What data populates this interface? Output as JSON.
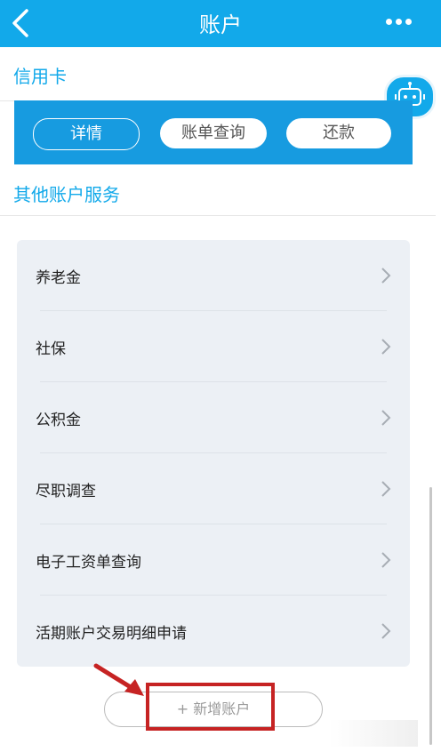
{
  "header": {
    "title": "账户",
    "back_icon": "chevron-left-icon",
    "more_icon": "more-dots-icon",
    "bar_color": "#12a9ea"
  },
  "credit_card": {
    "section_title": "信用卡",
    "buttons": [
      "详情",
      "账单查询",
      "还款"
    ]
  },
  "other_services": {
    "section_title": "其他账户服务",
    "items": [
      {
        "label": "养老金"
      },
      {
        "label": "社保"
      },
      {
        "label": "公积金"
      },
      {
        "label": "尽职调查"
      },
      {
        "label": "电子工资单查询"
      },
      {
        "label": "活期账户交易明细申请"
      }
    ]
  },
  "add_account": {
    "label": "+ 新增账户"
  },
  "assistant": {
    "icon": "robot-icon"
  },
  "annotation_color": "#c62323"
}
